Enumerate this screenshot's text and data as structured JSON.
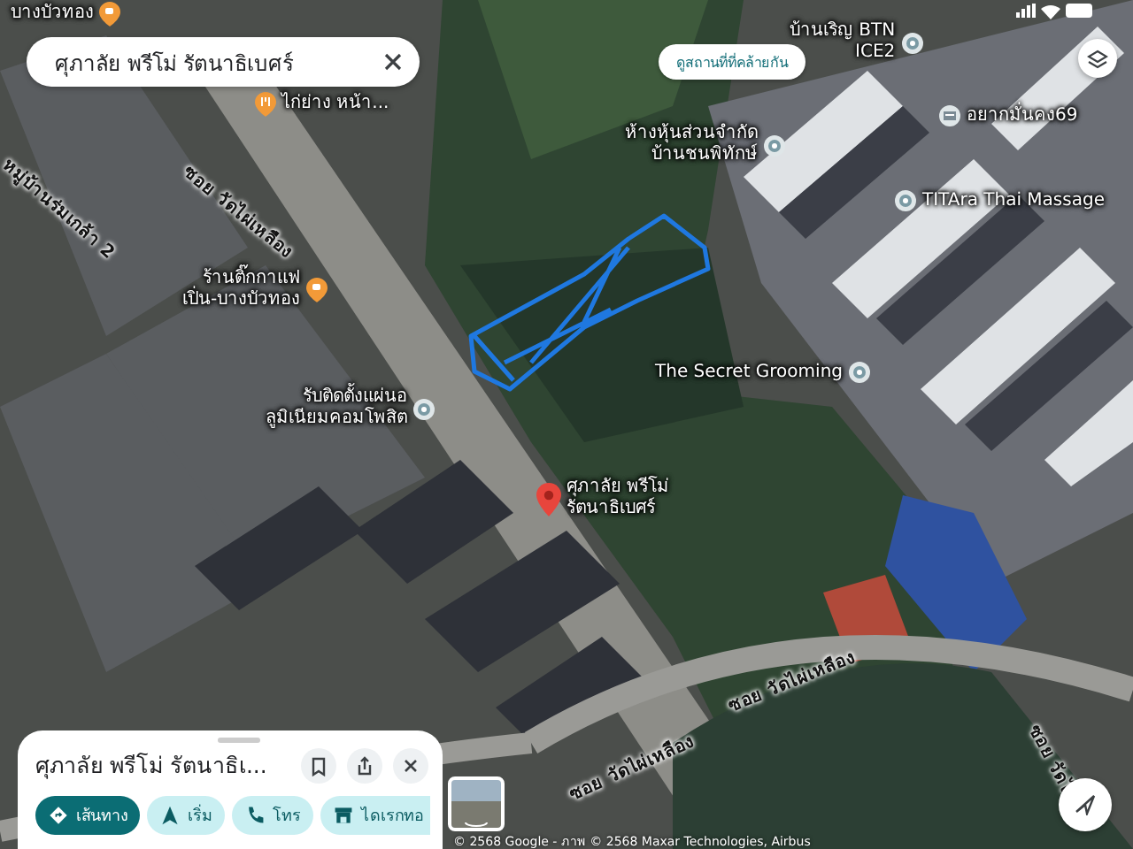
{
  "search_bar": {
    "value": "ศุภาลัย พรีโม่ รัตนาธิเบศร์"
  },
  "similar_places_button": {
    "label": "ดูสถานที่ที่คล้ายกัน"
  },
  "map": {
    "labels": [
      {
        "kind": "cafe",
        "lines": [
          "บางบัวทอง"
        ]
      },
      {
        "kind": "restaurant",
        "lines": [
          "ไก่ย่าง หน้า..."
        ]
      },
      {
        "kind": "road",
        "lines": [
          "ซอย วัดไผ่เหลือง"
        ]
      },
      {
        "kind": "road",
        "lines": [
          "หมู่บ้านร่มเกล้า 2"
        ]
      },
      {
        "kind": "cafe",
        "lines": [
          "ร้านติ๊กกาแฟ",
          "เปิ่น-บางบัวทอง"
        ]
      },
      {
        "kind": "business",
        "lines": [
          "รับติดตั้งแผ่นอ",
          "ลูมิเนียมคอมโพสิต"
        ]
      },
      {
        "kind": "pin",
        "lines": [
          "ศุภาลัย พรีโม่",
          "รัตนาธิเบศร์"
        ]
      },
      {
        "kind": "business",
        "lines": [
          "บ้านเริญ BTN",
          "ICE2"
        ]
      },
      {
        "kind": "office",
        "lines": [
          "อยากมั่นคง69"
        ]
      },
      {
        "kind": "business",
        "lines": [
          "ห้างหุ้นส่วนจำกัด",
          "บ้านชนพิทักษ์"
        ]
      },
      {
        "kind": "business",
        "lines": [
          "TITAra Thai Massage"
        ]
      },
      {
        "kind": "business",
        "lines": [
          "The Secret Grooming"
        ]
      },
      {
        "kind": "road",
        "lines": [
          "ซอย วัดไผ่เหลือง"
        ]
      },
      {
        "kind": "road",
        "lines": [
          "ซอย วัดไผ่เหลือง"
        ]
      },
      {
        "kind": "road",
        "lines": [
          "ซอย วัดไ"
        ]
      }
    ]
  },
  "attribution": "© 2568 Google - ภาพ © 2568 Maxar Technologies, Airbus",
  "place_sheet": {
    "title": "ศุภาลัย พรีโม่ รัตนาธิเ...",
    "actions": [
      {
        "kind": "directions",
        "label": "เส้นทาง",
        "selected": true
      },
      {
        "kind": "start",
        "label": "เริ่ม",
        "selected": false
      },
      {
        "kind": "call",
        "label": "โทร",
        "selected": false
      },
      {
        "kind": "directory",
        "label": "ไดเรกทอ",
        "selected": false
      }
    ]
  }
}
